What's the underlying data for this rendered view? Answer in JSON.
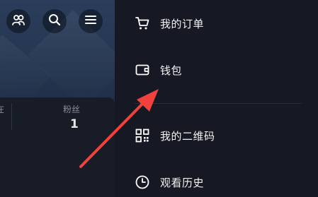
{
  "profile": {
    "stats": {
      "partial_label": "在",
      "fans_label": "粉丝",
      "fans_value": "1"
    },
    "top_buttons": [
      {
        "icon": "friends-icon"
      },
      {
        "icon": "search-icon"
      },
      {
        "icon": "menu-icon"
      }
    ]
  },
  "drawer": {
    "items": [
      {
        "label": "我的订单",
        "icon": "cart-icon"
      },
      {
        "label": "钱包",
        "icon": "wallet-icon"
      },
      {
        "label": "我的二维码",
        "icon": "qrcode-icon"
      },
      {
        "label": "观看历史",
        "icon": "clock-icon"
      }
    ]
  },
  "colors": {
    "drawer_bg": "#161823",
    "annotation_arrow": "#f0413c"
  }
}
